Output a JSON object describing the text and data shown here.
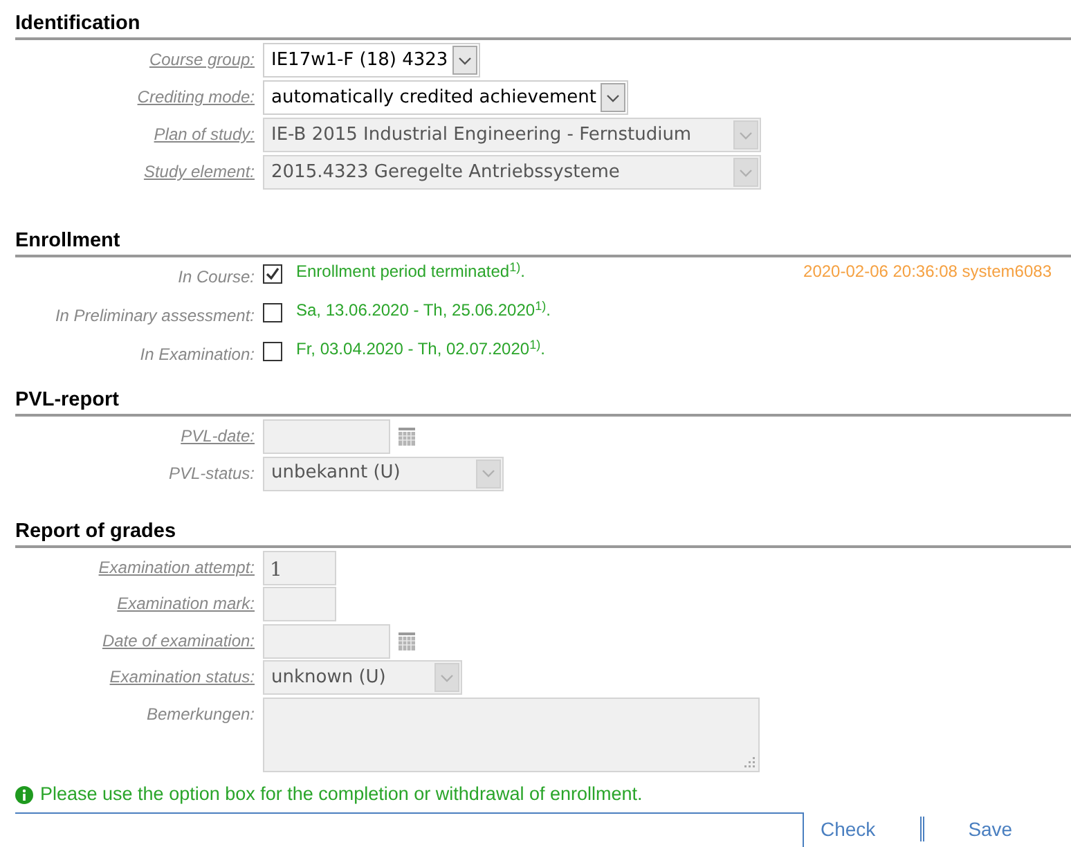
{
  "sections": [
    {
      "title": "Identification",
      "rows": [
        {
          "kind": "select",
          "label": "Course group:",
          "underlined": true,
          "value": "IE17w1-F (18) 4323",
          "disabled": false
        },
        {
          "kind": "select",
          "label": "Crediting mode:",
          "underlined": true,
          "value": "automatically credited achievement",
          "disabled": false
        },
        {
          "kind": "select",
          "label": "Plan of study:",
          "underlined": true,
          "value": "IE-B 2015 Industrial Engineering - Fernstudium",
          "disabled": true
        },
        {
          "kind": "select",
          "label": "Study element:",
          "underlined": true,
          "value": "2015.4323 Geregelte Antriebssysteme",
          "disabled": true
        }
      ]
    },
    {
      "title": "Enrollment",
      "rows": [
        {
          "kind": "checkbox",
          "label": "In Course:",
          "underlined": false,
          "checked": true,
          "text": "Enrollment period terminated$^{1)}$.",
          "timestamp": "2020-02-06 20:36:08 system6083"
        },
        {
          "kind": "checkbox",
          "label": "In Preliminary assessment:",
          "underlined": false,
          "checked": false,
          "text": "Sa, 13.06.2020 - Th, 25.06.2020$^{1)}$."
        },
        {
          "kind": "checkbox",
          "label": "In Examination:",
          "underlined": false,
          "checked": false,
          "text": "Fr, 03.04.2020 - Th, 02.07.2020$^{1)}$."
        }
      ]
    },
    {
      "title": "PVL-report",
      "rows": [
        {
          "kind": "date",
          "label": "PVL-date:",
          "underlined": true
        },
        {
          "kind": "select",
          "label": "PVL-status:",
          "underlined": false,
          "value": "unbekannt (U)",
          "disabled": true
        }
      ]
    },
    {
      "title": "Report of grades",
      "rows": [
        {
          "kind": "text",
          "label": "Examination attempt:",
          "underlined": true,
          "value": "1"
        },
        {
          "kind": "text",
          "label": "Examination mark:",
          "underlined": true
        },
        {
          "kind": "date",
          "label": "Date of examination:",
          "underlined": true
        },
        {
          "kind": "select",
          "label": "Examination status:",
          "underlined": true,
          "value": "unknown (U)",
          "disabled": true
        },
        {
          "kind": "textarea",
          "label": "Bemerkungen:",
          "underlined": false
        }
      ]
    }
  ],
  "info_message": "Please use the option box for the completion or withdrawal of enrollment.",
  "buttons": [
    "Check",
    "Save"
  ]
}
